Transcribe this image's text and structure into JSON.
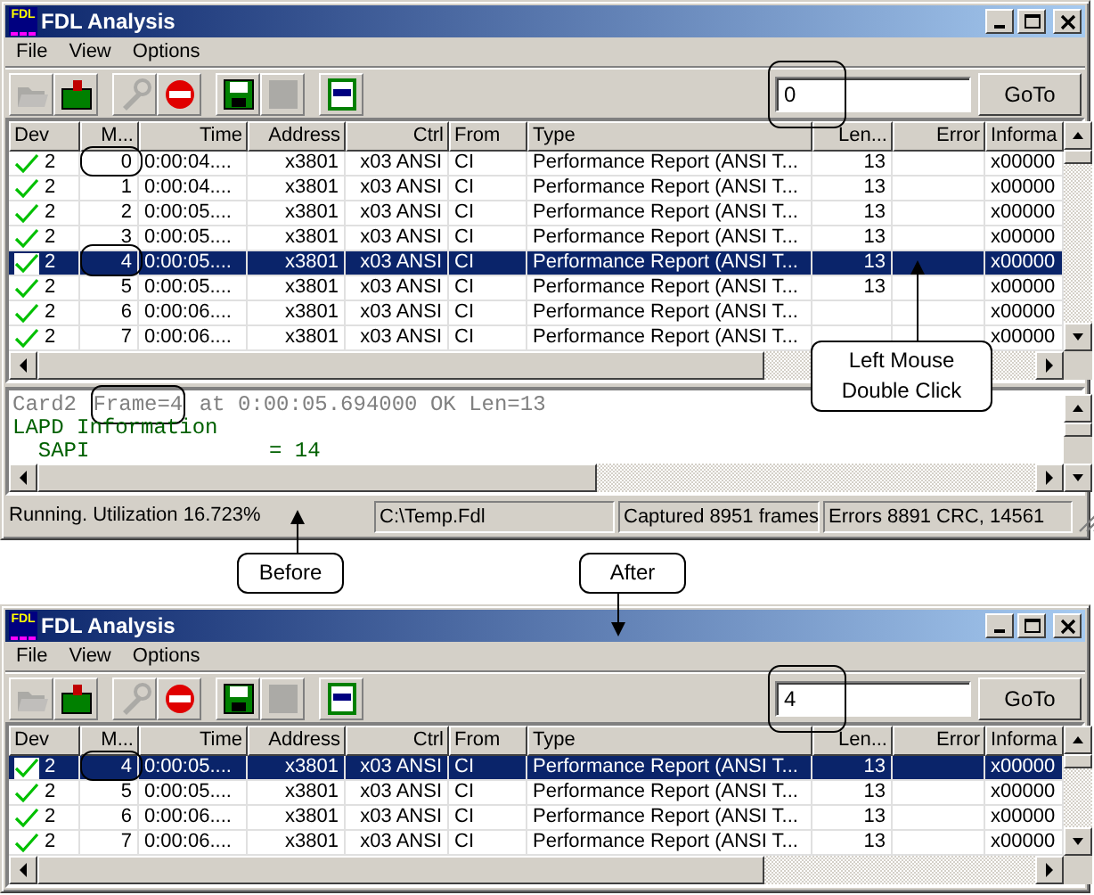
{
  "windows": [
    {
      "title": "FDL Analysis",
      "app_icon_text": "FDL",
      "menu": [
        "File",
        "View",
        "Options"
      ],
      "toolbar": [
        {
          "kind": "open-folder",
          "disabled": true
        },
        {
          "kind": "capture-folder",
          "disabled": false
        },
        {
          "kind": "tool",
          "disabled": true
        },
        {
          "kind": "stop",
          "disabled": false
        },
        {
          "kind": "save",
          "disabled": false
        },
        {
          "kind": "blank",
          "disabled": true
        },
        {
          "kind": "panel",
          "disabled": false
        }
      ],
      "goto": {
        "value": "0",
        "circled": true,
        "button": "GoTo"
      },
      "columns": [
        "Dev",
        "M...",
        "Time",
        "Address",
        "Ctrl",
        "From",
        "Type",
        "Len...",
        "Error",
        "Informa"
      ],
      "rows": [
        {
          "dev": "2",
          "m": "0",
          "time": "0:00:04....",
          "address": "x3801",
          "ctrl": "x03 ANSI",
          "from": "CI",
          "type": "Performance Report (ANSI T...",
          "len": "13",
          "info": "x00000",
          "selected": false,
          "circled": true
        },
        {
          "dev": "2",
          "m": "1",
          "time": "0:00:04....",
          "address": "x3801",
          "ctrl": "x03 ANSI",
          "from": "CI",
          "type": "Performance Report (ANSI T...",
          "len": "13",
          "info": "x00000",
          "selected": false,
          "circled": false
        },
        {
          "dev": "2",
          "m": "2",
          "time": "0:00:05....",
          "address": "x3801",
          "ctrl": "x03 ANSI",
          "from": "CI",
          "type": "Performance Report (ANSI T...",
          "len": "13",
          "info": "x00000",
          "selected": false,
          "circled": false
        },
        {
          "dev": "2",
          "m": "3",
          "time": "0:00:05....",
          "address": "x3801",
          "ctrl": "x03 ANSI",
          "from": "CI",
          "type": "Performance Report (ANSI T...",
          "len": "13",
          "info": "x00000",
          "selected": false,
          "circled": false
        },
        {
          "dev": "2",
          "m": "4",
          "time": "0:00:05....",
          "address": "x3801",
          "ctrl": "x03 ANSI",
          "from": "CI",
          "type": "Performance Report (ANSI T...",
          "len": "13",
          "info": "x00000",
          "selected": true,
          "circled": true
        },
        {
          "dev": "2",
          "m": "5",
          "time": "0:00:05....",
          "address": "x3801",
          "ctrl": "x03 ANSI",
          "from": "CI",
          "type": "Performance Report (ANSI T...",
          "len": "13",
          "info": "x00000",
          "selected": false,
          "circled": false
        },
        {
          "dev": "2",
          "m": "6",
          "time": "0:00:06....",
          "address": "x3801",
          "ctrl": "x03 ANSI",
          "from": "CI",
          "type": "Performance Report (ANSI T...",
          "info": "x00000",
          "selected": false,
          "circled": false
        },
        {
          "dev": "2",
          "m": "7",
          "time": "0:00:06....",
          "address": "x3801",
          "ctrl": "x03 ANSI",
          "from": "CI",
          "type": "Performance Report (ANSI T...",
          "info": "x00000",
          "selected": false,
          "circled": false
        }
      ],
      "detail": [
        {
          "color": "#808080",
          "segments": [
            {
              "text": "Card2 ",
              "circled": false
            },
            {
              "text": "Frame=4",
              "circled": true
            },
            {
              "text": " at 0:00:05.694000 OK Len=13",
              "circled": false
            }
          ]
        },
        {
          "color": "#006000",
          "segments": [
            {
              "text": "LAPD Information",
              "circled": false
            }
          ]
        },
        {
          "color": "#006000",
          "segments": [
            {
              "text": "  SAPI              = 14",
              "circled": false
            }
          ]
        }
      ],
      "status": [
        "Running. Utilization 16.723%",
        "C:\\Temp.Fdl",
        "Captured 8951 frames",
        "Errors 8891 CRC, 14561"
      ]
    },
    {
      "title": "FDL Analysis",
      "app_icon_text": "FDL",
      "menu": [
        "File",
        "View",
        "Options"
      ],
      "toolbar": [
        {
          "kind": "open-folder",
          "disabled": true
        },
        {
          "kind": "capture-folder",
          "disabled": false
        },
        {
          "kind": "tool",
          "disabled": true
        },
        {
          "kind": "stop",
          "disabled": false
        },
        {
          "kind": "save",
          "disabled": false
        },
        {
          "kind": "blank",
          "disabled": true
        },
        {
          "kind": "panel",
          "disabled": false
        }
      ],
      "goto": {
        "value": "4",
        "circled": true,
        "button": "GoTo"
      },
      "columns": [
        "Dev",
        "M...",
        "Time",
        "Address",
        "Ctrl",
        "From",
        "Type",
        "Len...",
        "Error",
        "Informa"
      ],
      "rows": [
        {
          "dev": "2",
          "m": "4",
          "time": "0:00:05....",
          "address": "x3801",
          "ctrl": "x03 ANSI",
          "from": "CI",
          "type": "Performance Report (ANSI T...",
          "len": "13",
          "info": "x00000",
          "selected": true,
          "circled": true
        },
        {
          "dev": "2",
          "m": "5",
          "time": "0:00:05....",
          "address": "x3801",
          "ctrl": "x03 ANSI",
          "from": "CI",
          "type": "Performance Report (ANSI T...",
          "len": "13",
          "info": "x00000",
          "selected": false,
          "circled": false
        },
        {
          "dev": "2",
          "m": "6",
          "time": "0:00:06....",
          "address": "x3801",
          "ctrl": "x03 ANSI",
          "from": "CI",
          "type": "Performance Report (ANSI T...",
          "len": "13",
          "info": "x00000",
          "selected": false,
          "circled": false
        },
        {
          "dev": "2",
          "m": "7",
          "time": "0:00:06....",
          "address": "x3801",
          "ctrl": "x03 ANSI",
          "from": "CI",
          "type": "Performance Report (ANSI T...",
          "len": "13",
          "info": "x00000",
          "selected": false,
          "circled": false
        }
      ]
    }
  ],
  "callouts": [
    {
      "kind": "up",
      "text": "Left Mouse Double Click"
    },
    {
      "kind": "up",
      "text": "Before"
    },
    {
      "kind": "down",
      "text": "After"
    }
  ]
}
